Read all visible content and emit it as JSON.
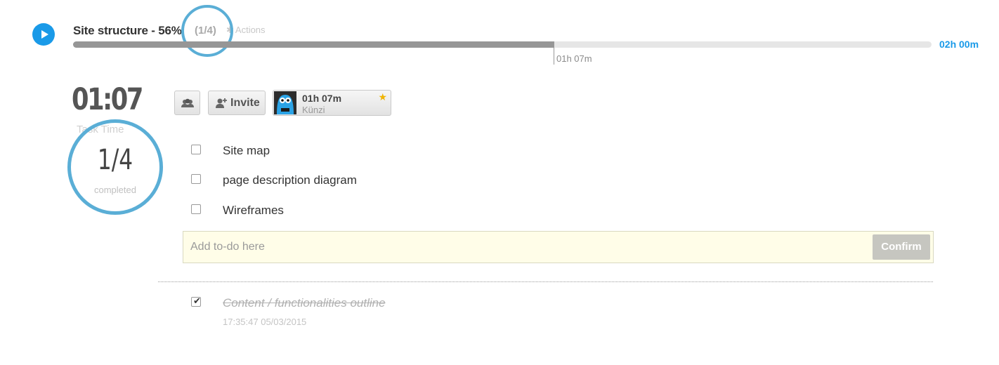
{
  "header": {
    "play_icon": "play-icon",
    "title": "Site structure - 56%",
    "count": "(1/4)",
    "actions_label": "Actions",
    "actions_icon": "gear-icon",
    "progress": {
      "fraction": 0.56,
      "elapsed_label": "01h 07m",
      "total_label": "02h 00m"
    },
    "accent_color": "#1a9ae8"
  },
  "timer": {
    "value": "01:07",
    "label": "Task Time"
  },
  "completion": {
    "ratio": "1/4",
    "label": "completed"
  },
  "toolbar": {
    "team_icon": "team-icon",
    "invite_icon": "add-user-icon",
    "invite_label": "Invite",
    "member": {
      "time": "01h 07m",
      "name": "Künzi",
      "star_icon": "star-icon",
      "star_color": "#f0b400"
    }
  },
  "todos": [
    {
      "label": "Site map",
      "checked": false
    },
    {
      "label": "page description diagram",
      "checked": false
    },
    {
      "label": "Wireframes",
      "checked": false
    }
  ],
  "add_todo": {
    "placeholder": "Add to-do here",
    "value": "",
    "confirm_label": "Confirm"
  },
  "completed": [
    {
      "label": "Content / functionalities outline",
      "date": "17:35:47 05/03/2015",
      "checked": true
    }
  ]
}
